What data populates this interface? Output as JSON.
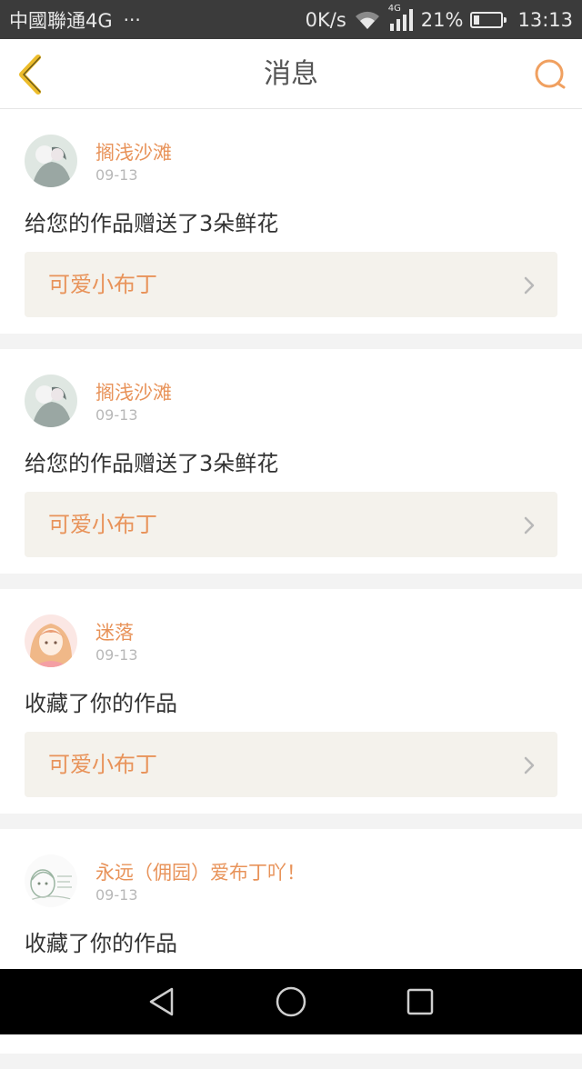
{
  "status_bar": {
    "carrier": "中國聯通4G",
    "more": "···",
    "net_speed": "0K/s",
    "network_type": "4G",
    "battery": "21%",
    "battery_level": 0.21,
    "time": "13:13"
  },
  "nav": {
    "title": "消息",
    "back_icon": "chevron-left-icon",
    "search_icon": "search-icon"
  },
  "accent_color": "#e8935a",
  "messages": [
    {
      "user": "搁浅沙滩",
      "date": "09-13",
      "action": "给您的作品赠送了3朵鲜花",
      "work": "可爱小布丁"
    },
    {
      "user": "搁浅沙滩",
      "date": "09-13",
      "action": "给您的作品赠送了3朵鲜花",
      "work": "可爱小布丁"
    },
    {
      "user": "迷落",
      "date": "09-13",
      "action": "收藏了你的作品",
      "work": "可爱小布丁"
    },
    {
      "user": "永远（佣园）爱布丁吖！",
      "date": "09-13",
      "action": "收藏了你的作品",
      "work": ""
    }
  ],
  "system_nav": {
    "back": "back-triangle-icon",
    "home": "home-circle-icon",
    "recents": "recents-square-icon"
  }
}
